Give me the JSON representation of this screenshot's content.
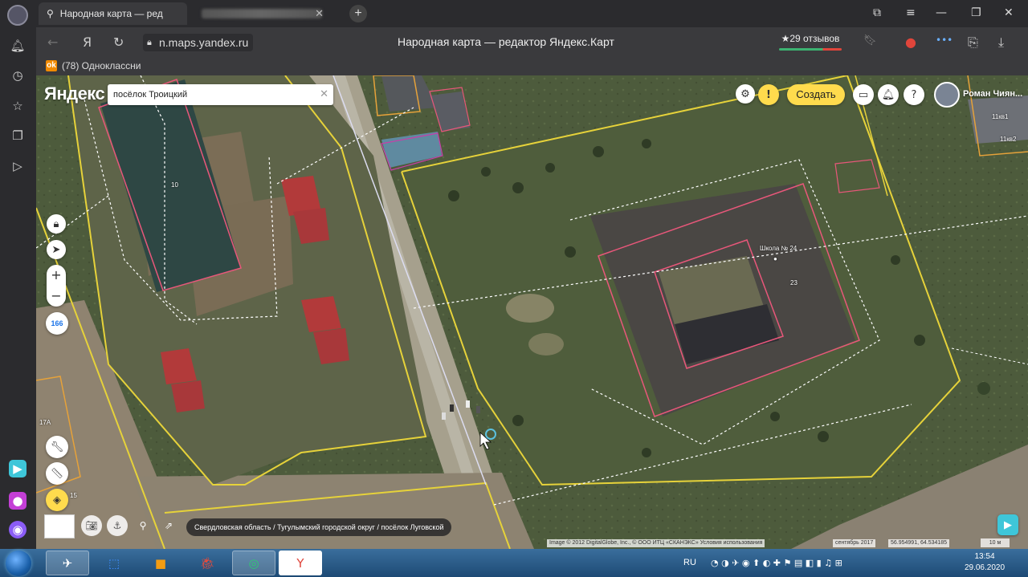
{
  "browser": {
    "active_tab_title": "Народная карта — ред",
    "url": "n.maps.yandex.ru",
    "page_title": "Народная карта — редактор Яндекс.Карт",
    "reviews_label": "★29 отзывов",
    "bookmark_label": "(78) Одноклассни",
    "bookmark_icon_letter": "ok",
    "yandex_nav_letter": "Я"
  },
  "map": {
    "logo": "Яндекс",
    "search_value": "посёлок Троицкий",
    "create_button": "Создать",
    "warning_symbol": "!",
    "help_symbol": "?",
    "user_name": "Роман Чиян...",
    "zoom_in": "+",
    "zoom_out": "−",
    "zoom_level": "166",
    "breadcrumb": "Свердловская область / Тугулымский городской округ / посёлок Луговской",
    "copyright": "Image © 2012 DigitalGlobe, Inc., © ООО ИТЦ «СКАНЭКС» Условия использования",
    "imagery_date": "сентябрь 2017",
    "coordinates": "56.954991, 64.534185",
    "scale": "10 м",
    "labels": {
      "house_10": "10",
      "school": "Школа № 24",
      "house_23": "23",
      "house_17a": "17А",
      "house_15": "15",
      "house_11kv1": "11кв1",
      "house_11kv2": "11кв2"
    }
  },
  "taskbar": {
    "lang": "RU",
    "time": "13:54",
    "date": "29.06.2020"
  },
  "colors": {
    "accent_yellow": "#ffdb4d",
    "parcel_yellow": "#e6d23a",
    "building_pink": "#e8577a",
    "browser_dark": "#2b2b2e"
  }
}
